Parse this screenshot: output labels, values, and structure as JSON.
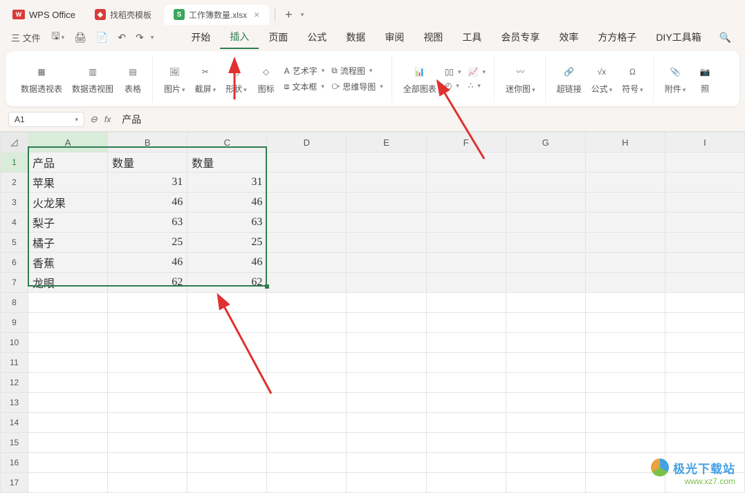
{
  "app": {
    "name": "WPS Office",
    "logo_text": "W"
  },
  "tabs": [
    {
      "icon": "red",
      "icon_text": "",
      "label": "找稻壳模板",
      "active": false
    },
    {
      "icon": "green",
      "icon_text": "S",
      "label": "工作簿数量.xlsx",
      "active": true
    }
  ],
  "menu_left": {
    "file": "三 文件"
  },
  "menu_tabs": [
    "开始",
    "插入",
    "页面",
    "公式",
    "数据",
    "审阅",
    "视图",
    "工具",
    "会员专享",
    "效率",
    "方方格子",
    "DIY工具箱"
  ],
  "menu_active": "插入",
  "ribbon": {
    "pivot_table": "数据透视表",
    "pivot_chart": "数据透视图",
    "table": "表格",
    "image": "图片",
    "screenshot": "截屏",
    "shape": "形状",
    "icon": "图标",
    "art_text": "艺术字",
    "textbox": "文本框",
    "flowchart": "流程图",
    "mindmap": "思维导图",
    "all_charts": "全部图表",
    "sparkline": "迷你图",
    "hyperlink": "超链接",
    "formula": "公式",
    "symbol": "符号",
    "attachment": "附件",
    "camera": "照"
  },
  "cell_ref": "A1",
  "fx_value": "产品",
  "columns": [
    "A",
    "B",
    "C",
    "D",
    "E",
    "F",
    "G",
    "H",
    "I"
  ],
  "rows": 17,
  "data": {
    "headers": [
      "产品",
      "数量",
      "数量"
    ],
    "rows": [
      {
        "p": "苹果",
        "q1": 31,
        "q2": 31
      },
      {
        "p": "火龙果",
        "q1": 46,
        "q2": 46
      },
      {
        "p": "梨子",
        "q1": 63,
        "q2": 63
      },
      {
        "p": "橘子",
        "q1": 25,
        "q2": 25
      },
      {
        "p": "香蕉",
        "q1": 46,
        "q2": 46
      },
      {
        "p": "龙眼",
        "q1": 62,
        "q2": 62
      }
    ]
  },
  "watermark": {
    "title": "极光下载站",
    "url": "www.xz7.com"
  }
}
